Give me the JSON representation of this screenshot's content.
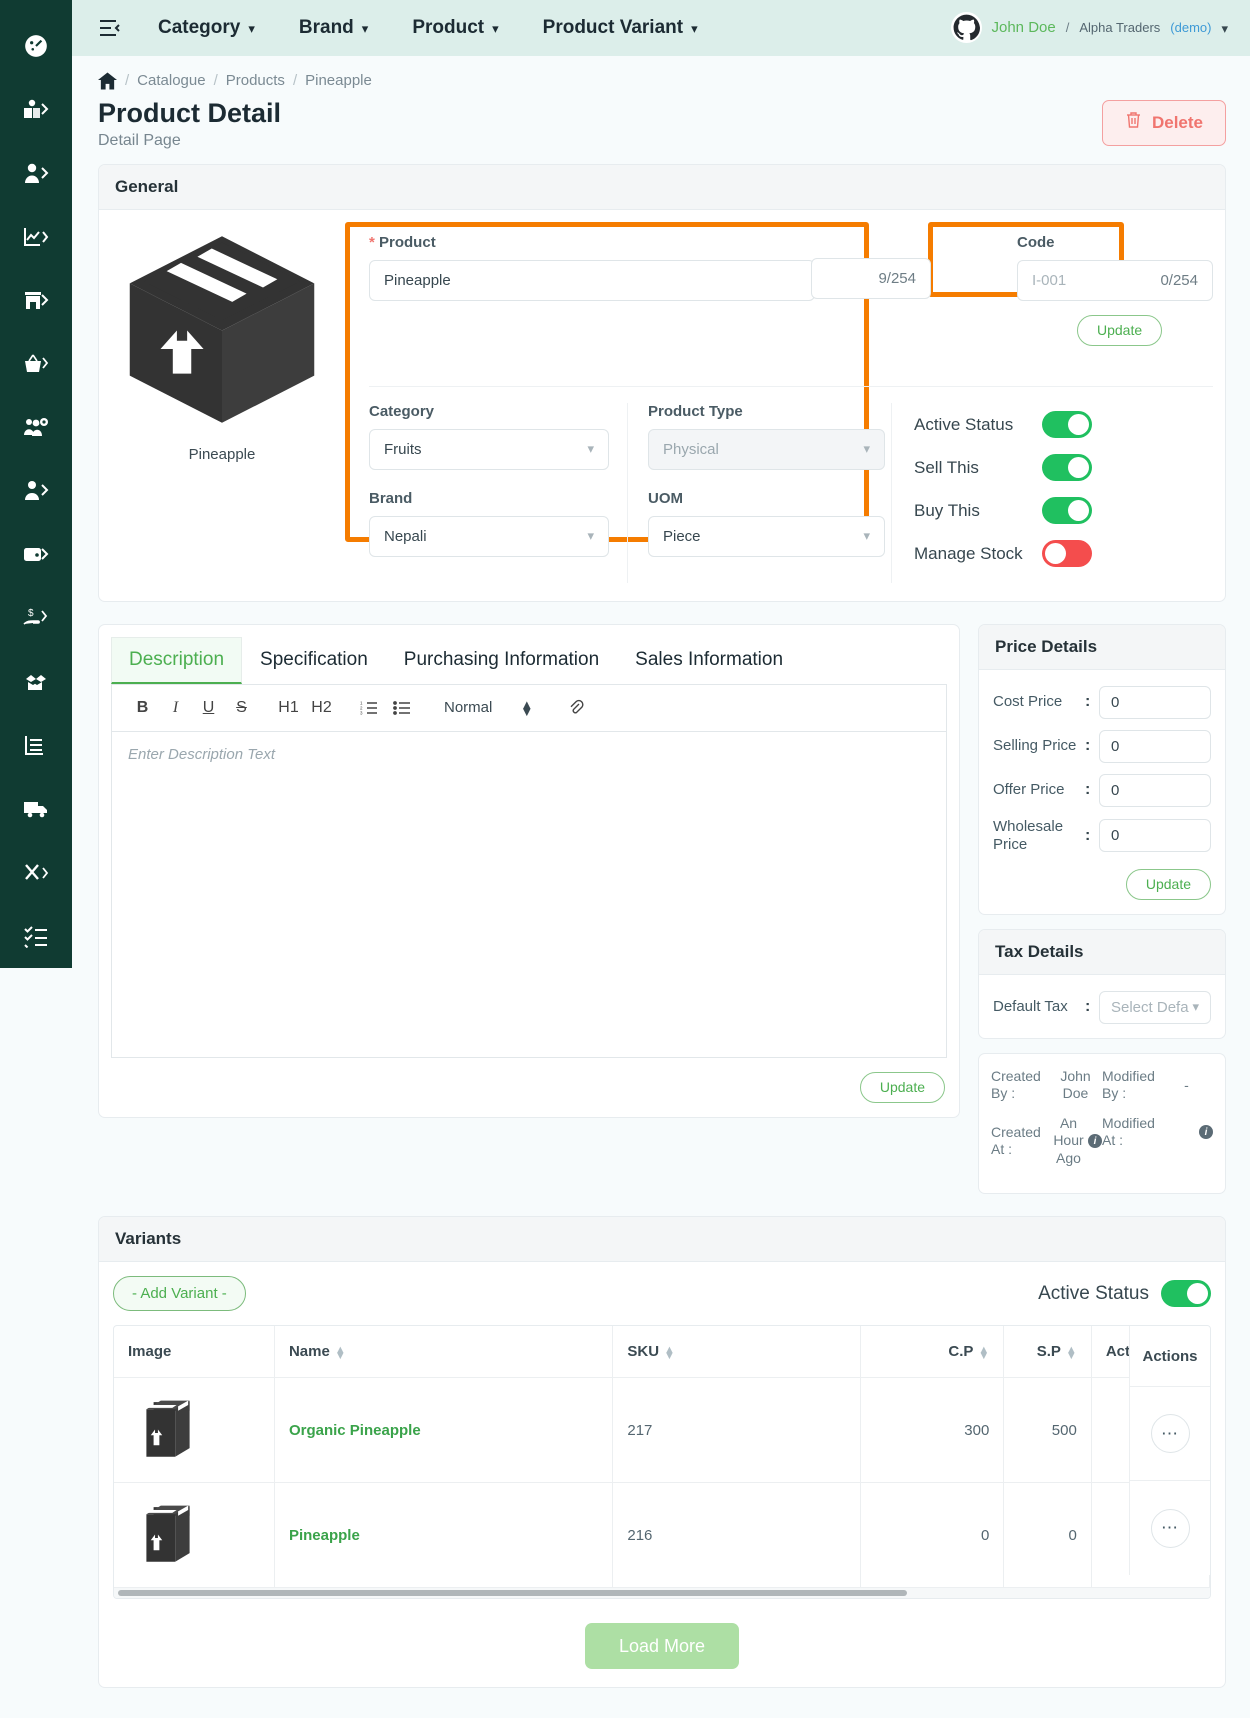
{
  "sidebar": {
    "items": [
      {
        "name": "dashboard",
        "icon": "gauge-icon"
      },
      {
        "name": "catalogue",
        "icon": "book-user-icon"
      },
      {
        "name": "customers",
        "icon": "user-arrow-icon"
      },
      {
        "name": "reports",
        "icon": "chart-line-icon"
      },
      {
        "name": "store",
        "icon": "store-icon"
      },
      {
        "name": "sales",
        "icon": "basket-icon"
      },
      {
        "name": "user-management",
        "icon": "users-gear-icon"
      },
      {
        "name": "employees",
        "icon": "user-tie-icon"
      },
      {
        "name": "wallet",
        "icon": "wallet-icon"
      },
      {
        "name": "payments",
        "icon": "hand-money-icon"
      },
      {
        "name": "inventory",
        "icon": "open-box-icon"
      },
      {
        "name": "accounts",
        "icon": "ledger-icon"
      },
      {
        "name": "delivery",
        "icon": "truck-icon"
      },
      {
        "name": "tools",
        "icon": "tools-icon"
      },
      {
        "name": "tasks",
        "icon": "checklist-icon"
      }
    ]
  },
  "topbar": {
    "menu_icon": "hamburger-icon",
    "nav": [
      {
        "label": "Category"
      },
      {
        "label": "Brand"
      },
      {
        "label": "Product"
      },
      {
        "label": "Product Variant"
      }
    ],
    "user": {
      "name": "John Doe",
      "separator": "/",
      "org": "Alpha Traders",
      "tag": "(demo)",
      "avatar_icon": "github-avatar-icon"
    }
  },
  "breadcrumb": {
    "home_icon": "home-icon",
    "items": [
      "Catalogue",
      "Products",
      "Pineapple"
    ],
    "separator": "/"
  },
  "page": {
    "title": "Product Detail",
    "subtitle": "Detail Page",
    "delete_label": "Delete",
    "delete_icon": "trash-icon"
  },
  "general": {
    "section_title": "General",
    "image_caption": "Pineapple",
    "image_icon": "package-box-icon",
    "product": {
      "label": "Product",
      "required_mark": "*",
      "value": "Pineapple",
      "counter": "9/254"
    },
    "code": {
      "label": "Code",
      "placeholder": "I-001",
      "counter": "0/254"
    },
    "update_label": "Update",
    "category": {
      "label": "Category",
      "value": "Fruits"
    },
    "product_type": {
      "label": "Product Type",
      "value": "Physical"
    },
    "brand": {
      "label": "Brand",
      "value": "Nepali"
    },
    "uom": {
      "label": "UOM",
      "value": "Piece"
    },
    "toggles": [
      {
        "label": "Active Status",
        "state": "on"
      },
      {
        "label": "Sell This",
        "state": "on"
      },
      {
        "label": "Buy This",
        "state": "on"
      },
      {
        "label": "Manage Stock",
        "state": "off"
      }
    ]
  },
  "editor": {
    "tabs": [
      {
        "label": "Description",
        "active": true
      },
      {
        "label": "Specification",
        "active": false
      },
      {
        "label": "Purchasing Information",
        "active": false
      },
      {
        "label": "Sales Information",
        "active": false
      }
    ],
    "toolbar": {
      "bold": "B",
      "italic": "I",
      "underline": "U",
      "strike": "S",
      "h1": "H1",
      "h2": "H2",
      "ordered_list_icon": "ordered-list-icon",
      "bullet_list_icon": "bullet-list-icon",
      "format": "Normal",
      "spinner_icon": "updown-arrows-icon",
      "link_icon": "attachment-icon"
    },
    "placeholder": "Enter Description Text",
    "update_label": "Update"
  },
  "price_details": {
    "title": "Price Details",
    "colon": ":",
    "rows": [
      {
        "label": "Cost Price",
        "value": "0"
      },
      {
        "label": "Selling Price",
        "value": "0"
      },
      {
        "label": "Offer Price",
        "value": "0"
      },
      {
        "label": "Wholesale Price",
        "value": "0"
      }
    ],
    "update_label": "Update"
  },
  "tax_details": {
    "title": "Tax Details",
    "label": "Default Tax",
    "colon": ":",
    "placeholder": "Select Defa"
  },
  "meta": {
    "created_by_label": "Created By :",
    "created_by_value": "John Doe",
    "modified_by_label": "Modified By :",
    "modified_by_value": "-",
    "modified_by_value2": "-",
    "created_at_label": "Created At :",
    "created_at_value": "An Hour Ago",
    "modified_at_label": "Modified At :",
    "info_icon": "info-icon"
  },
  "variants": {
    "title": "Variants",
    "add_label": "- Add Variant -",
    "active_status_label": "Active Status",
    "active_status_state": "on",
    "columns": [
      "Image",
      "Name",
      "SKU",
      "C.P",
      "S.P",
      "Actions"
    ],
    "rows": [
      {
        "image_icon": "package-box-icon",
        "name": "Organic Pineapple",
        "sku": "217",
        "cp": "300",
        "sp": "500",
        "actions_icon": "ellipsis-icon"
      },
      {
        "image_icon": "package-box-icon",
        "name": "Pineapple",
        "sku": "216",
        "cp": "0",
        "sp": "0",
        "actions_icon": "ellipsis-icon"
      }
    ],
    "load_more_label": "Load More"
  },
  "colors": {
    "sidebar_bg": "#103b32",
    "topbar_bg": "#dceeea",
    "accent_green": "#4caf50",
    "toggle_on": "#20c060",
    "toggle_off": "#f44d4d",
    "highlight": "#f57c00",
    "danger": "#f0756f",
    "page_bg": "#f7fbfc"
  }
}
